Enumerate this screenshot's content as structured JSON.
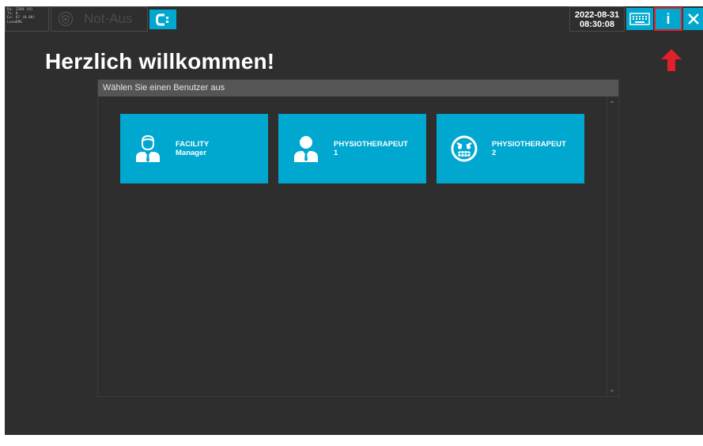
{
  "status_panel": {
    "line1": "Rx: 2304 (0)",
    "line2": "Tx: 0",
    "line3": "Ex: 67 (0.00)",
    "line4": "LunaEMG"
  },
  "emergency_stop": {
    "label": "Not-Aus",
    "icon": "shield-icon"
  },
  "connect_button": {
    "icon": "connection-icon"
  },
  "datetime": {
    "date": "2022-08-31",
    "time": "08:30:08"
  },
  "toolbar": {
    "keyboard_icon": "keyboard-icon",
    "info_label": "i",
    "close_icon": "close-icon"
  },
  "page": {
    "title": "Herzlich willkommen!"
  },
  "user_panel": {
    "header": "Wählen Sie einen Benutzer aus",
    "users": [
      {
        "line1": "FACILITY",
        "line2": "Manager",
        "icon": "manager-avatar-icon"
      },
      {
        "line1": "PHYSIOTHERAPEUT",
        "line2": "1",
        "icon": "person-avatar-icon"
      },
      {
        "line1": "PHYSIOTHERAPEUT",
        "line2": "2",
        "icon": "angry-face-icon"
      }
    ]
  },
  "colors": {
    "accent": "#00a7cf",
    "background": "#2e2e2e",
    "highlight": "#e0202a"
  }
}
